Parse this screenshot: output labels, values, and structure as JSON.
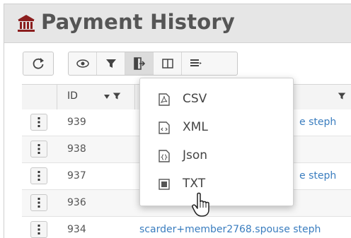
{
  "window": {
    "title": "Payment History",
    "title_icon": "bank-icon"
  },
  "toolbar": {
    "buttons": [
      "refresh-icon",
      "eye-icon",
      "filter-icon",
      "export-icon",
      "columns-icon",
      "list-icon"
    ],
    "active": "export-icon"
  },
  "grid": {
    "headers": {
      "id": "ID"
    },
    "rows": [
      {
        "id": "939",
        "link": "e steph"
      },
      {
        "id": "938",
        "link": ""
      },
      {
        "id": "937",
        "link": "e steph"
      },
      {
        "id": "936",
        "link": ""
      },
      {
        "id": "934",
        "link": "scarder+member2768.spouse steph"
      }
    ]
  },
  "export_menu": {
    "items": [
      {
        "label": "CSV",
        "icon": "pdf-file-icon"
      },
      {
        "label": "XML",
        "icon": "code-file-icon"
      },
      {
        "label": "Json",
        "icon": "json-file-icon"
      },
      {
        "label": "TXT",
        "icon": "txt-file-icon"
      }
    ]
  },
  "colors": {
    "accent": "#8b1e1e",
    "link": "#3a7dbf",
    "title_bg": "#e6e6e6"
  }
}
